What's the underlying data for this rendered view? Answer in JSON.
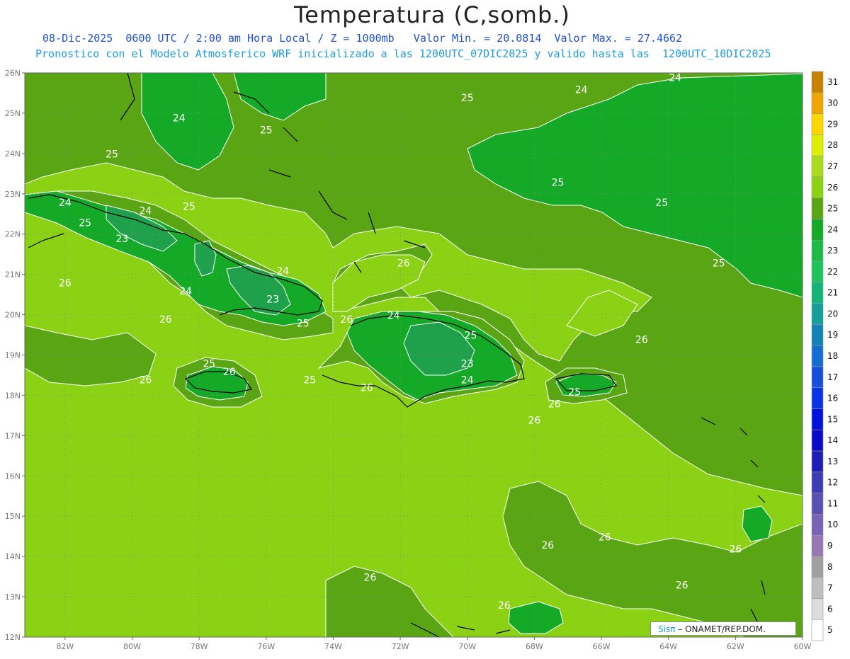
{
  "header": {
    "title": "Temperatura (C,somb.)",
    "line1": "08-Dic-2025  0600 UTC / 2:00 am Hora Local / Z = 1000mb   Valor Min. = 20.0814  Valor Max. = 27.4662",
    "line2": "Pronostico con el Modelo Atmosferico WRF inicializado a las 1200UTC_07DIC2025 y valido hasta las  1200UTC_10DIC2025"
  },
  "map": {
    "lon_range": [
      -83.2,
      -60
    ],
    "lat_range": [
      12,
      26
    ],
    "lat_ticks": [
      "26N",
      "25N",
      "24N",
      "23N",
      "22N",
      "21N",
      "20N",
      "19N",
      "18N",
      "17N",
      "16N",
      "15N",
      "14N",
      "13N",
      "12N"
    ],
    "lon_ticks": [
      "82W",
      "80W",
      "78W",
      "76W",
      "74W",
      "72W",
      "70W",
      "68W",
      "66W",
      "64W",
      "62W",
      "60W"
    ],
    "grid": true,
    "contour_labels": [
      {
        "text": "24",
        "lon": -79.6,
        "lat": 22.5
      },
      {
        "text": "24",
        "lon": -82.0,
        "lat": 22.7
      },
      {
        "text": "25",
        "lon": -81.4,
        "lat": 22.2
      },
      {
        "text": "23",
        "lon": -80.3,
        "lat": 21.8
      },
      {
        "text": "25",
        "lon": -78.3,
        "lat": 22.6
      },
      {
        "text": "24",
        "lon": -78.6,
        "lat": 24.8
      },
      {
        "text": "25",
        "lon": -76.0,
        "lat": 24.5
      },
      {
        "text": "25",
        "lon": -80.6,
        "lat": 23.9
      },
      {
        "text": "24",
        "lon": -75.5,
        "lat": 21.0
      },
      {
        "text": "23",
        "lon": -75.8,
        "lat": 20.3
      },
      {
        "text": "24",
        "lon": -78.4,
        "lat": 20.5
      },
      {
        "text": "26",
        "lon": -82.0,
        "lat": 20.7
      },
      {
        "text": "26",
        "lon": -79.0,
        "lat": 19.8
      },
      {
        "text": "25",
        "lon": -74.9,
        "lat": 19.7
      },
      {
        "text": "26",
        "lon": -73.6,
        "lat": 19.8
      },
      {
        "text": "24",
        "lon": -72.2,
        "lat": 19.9
      },
      {
        "text": "25",
        "lon": -69.9,
        "lat": 19.4
      },
      {
        "text": "23",
        "lon": -70.0,
        "lat": 18.7
      },
      {
        "text": "24",
        "lon": -70.0,
        "lat": 18.3
      },
      {
        "text": "25",
        "lon": -77.7,
        "lat": 18.7
      },
      {
        "text": "26",
        "lon": -77.1,
        "lat": 18.5
      },
      {
        "text": "26",
        "lon": -79.6,
        "lat": 18.3
      },
      {
        "text": "25",
        "lon": -74.7,
        "lat": 18.3
      },
      {
        "text": "26",
        "lon": -73.0,
        "lat": 18.1
      },
      {
        "text": "26",
        "lon": -71.9,
        "lat": 21.2
      },
      {
        "text": "25",
        "lon": -70.0,
        "lat": 25.3
      },
      {
        "text": "24",
        "lon": -66.6,
        "lat": 25.5
      },
      {
        "text": "24",
        "lon": -63.8,
        "lat": 25.8
      },
      {
        "text": "25",
        "lon": -67.3,
        "lat": 23.2
      },
      {
        "text": "25",
        "lon": -64.2,
        "lat": 22.7
      },
      {
        "text": "25",
        "lon": -62.5,
        "lat": 21.2
      },
      {
        "text": "26",
        "lon": -64.8,
        "lat": 19.3
      },
      {
        "text": "26",
        "lon": -68.0,
        "lat": 17.3
      },
      {
        "text": "26",
        "lon": -67.4,
        "lat": 17.7
      },
      {
        "text": "25",
        "lon": -66.8,
        "lat": 18.0
      },
      {
        "text": "26",
        "lon": -67.6,
        "lat": 14.2
      },
      {
        "text": "26",
        "lon": -65.9,
        "lat": 14.4
      },
      {
        "text": "26",
        "lon": -62.0,
        "lat": 14.1
      },
      {
        "text": "26",
        "lon": -63.6,
        "lat": 13.2
      },
      {
        "text": "26",
        "lon": -72.9,
        "lat": 13.4
      },
      {
        "text": "26",
        "lon": -68.9,
        "lat": 12.7
      }
    ]
  },
  "colorbar": {
    "labels": [
      "5",
      "6",
      "7",
      "8",
      "9",
      "10",
      "11",
      "12",
      "13",
      "14",
      "15",
      "16",
      "17",
      "18",
      "19",
      "20",
      "21",
      "22",
      "23",
      "24",
      "25",
      "26",
      "27",
      "28",
      "29",
      "30",
      "31"
    ],
    "colors": [
      "#ffffff",
      "#dcdcdc",
      "#bebebe",
      "#a0a0a0",
      "#9678b4",
      "#7864b4",
      "#5a50b4",
      "#3c3cb4",
      "#1e1eb4",
      "#0a0ac8",
      "#0014dc",
      "#0a32e6",
      "#1450dc",
      "#146ed2",
      "#1482b4",
      "#14a096",
      "#14b478",
      "#1ec35a",
      "#1eb946",
      "#14aa28",
      "#5aa514",
      "#8cd214",
      "#aadc1e",
      "#dcf000",
      "#ffd700",
      "#f0a500",
      "#c88200"
    ],
    "base_color_24": "#14aa28"
  },
  "palette": {
    "t23": "#1fa04a",
    "t24": "#14aa28",
    "t25": "#5aa514",
    "t26": "#8cd214",
    "t27": "#aadc1e",
    "t22": "#2db67a"
  },
  "credit": {
    "sis": "Sisπ",
    "text": " – ONAMET/REP.DOM."
  }
}
